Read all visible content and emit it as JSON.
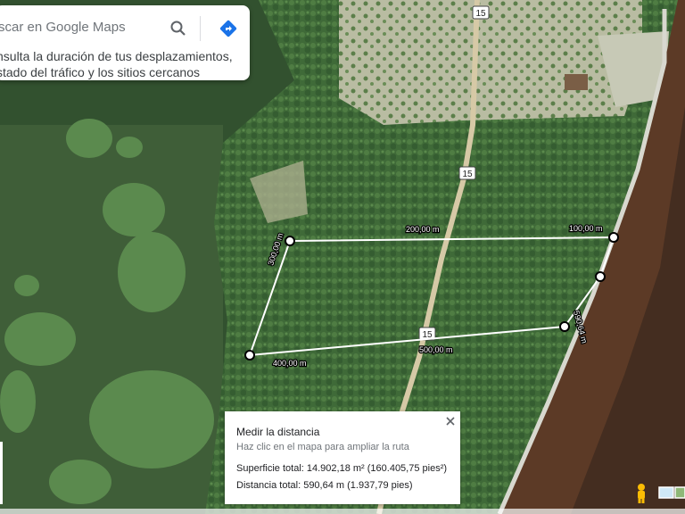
{
  "search": {
    "placeholder": "scar en Google Maps",
    "hint_line1": "nsulta la duración de tus desplazamientos,",
    "hint_line2": "stado del tráfico y los sitios cercanos"
  },
  "roads": {
    "route_number": "15"
  },
  "measure_labels": {
    "l100": "100,00 m",
    "l200": "200,00 m",
    "l300": "300,00 m",
    "l400": "400,00 m",
    "l500": "500,00 m",
    "l590": "590,64 m"
  },
  "panel": {
    "title": "Medir la distancia",
    "subtitle": "Haz clic en el mapa para ampliar la ruta",
    "area": "Superficie total: 14.902,18 m² (160.405,75 pies²)",
    "distance": "Distancia total: 590,64 m (1.937,79 pies)"
  },
  "colors": {
    "directions_blue": "#1a73e8",
    "measure_line": "#ffffff",
    "pegman": "#fbbc04"
  },
  "icons": [
    "search-icon",
    "directions-icon",
    "close-icon",
    "pegman-icon",
    "layers-icon"
  ]
}
